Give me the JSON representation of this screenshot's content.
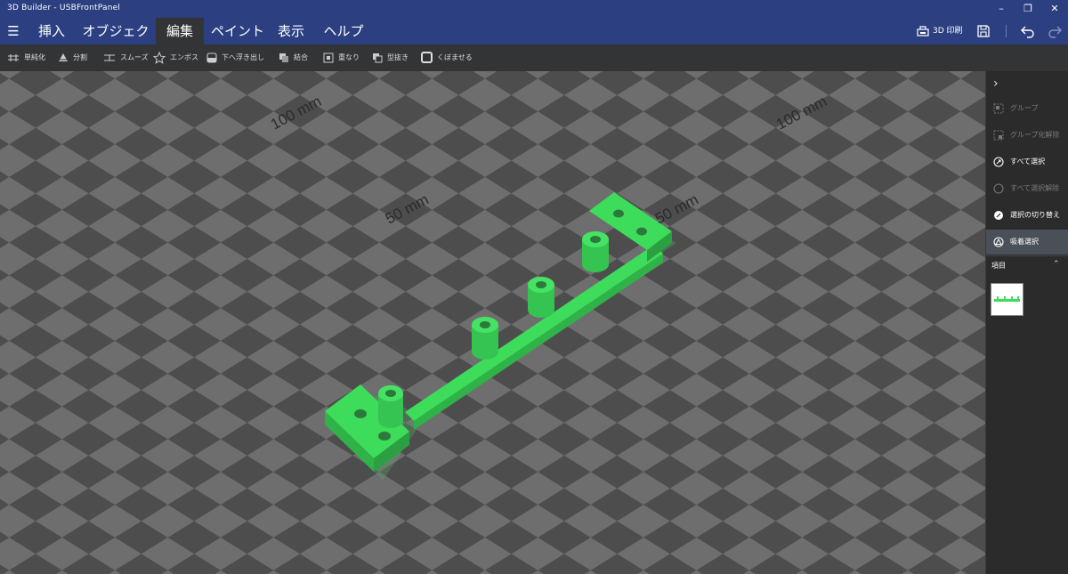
{
  "window": {
    "title": "3D Builder - USBFrontPanel"
  },
  "window_controls": [
    "minimize-icon",
    "restore-icon",
    "close-icon"
  ],
  "menu": {
    "tabs": [
      {
        "label": "挿入"
      },
      {
        "label": "オブジェクト"
      },
      {
        "label": "編集",
        "active": true
      },
      {
        "label": "ペイント"
      },
      {
        "label": "表示"
      },
      {
        "label": "ヘルプ"
      }
    ],
    "print_label": "3D 印刷"
  },
  "toolbar": {
    "items": [
      {
        "label": "単純化",
        "icon": "simplify-icon"
      },
      {
        "label": "分割",
        "icon": "split-icon"
      },
      {
        "label": "スムーズ",
        "icon": "smooth-icon"
      },
      {
        "label": "エンボス",
        "icon": "emboss-icon"
      },
      {
        "label": "下へ浮き出し",
        "icon": "extrude-down-icon"
      },
      {
        "label": "結合",
        "icon": "merge-icon"
      },
      {
        "label": "重なり",
        "icon": "intersect-icon"
      },
      {
        "label": "型抜き",
        "icon": "subtract-icon"
      },
      {
        "label": "くぼませる",
        "icon": "hollow-icon"
      }
    ]
  },
  "viewport": {
    "grid_labels": [
      "100 mm",
      "100 mm",
      "50 mm",
      "50 mm"
    ],
    "colors": {
      "model": "#3ddc5a",
      "grid_light": "#6e6e6e",
      "grid_dark": "#4d4d4d"
    }
  },
  "panel": {
    "items": [
      {
        "label": "グループ",
        "state": "disabled",
        "icon": "group-icon"
      },
      {
        "label": "グループ化解除",
        "state": "disabled",
        "icon": "ungroup-icon"
      },
      {
        "label": "すべて選択",
        "state": "enabled",
        "icon": "select-all-icon"
      },
      {
        "label": "すべて選択解除",
        "state": "disabled",
        "icon": "deselect-all-icon"
      },
      {
        "label": "選択の切り替え",
        "state": "enabled",
        "icon": "toggle-selection-icon"
      },
      {
        "label": "吸着選択",
        "state": "selected",
        "icon": "snap-select-icon"
      }
    ],
    "items_header": "項目"
  }
}
